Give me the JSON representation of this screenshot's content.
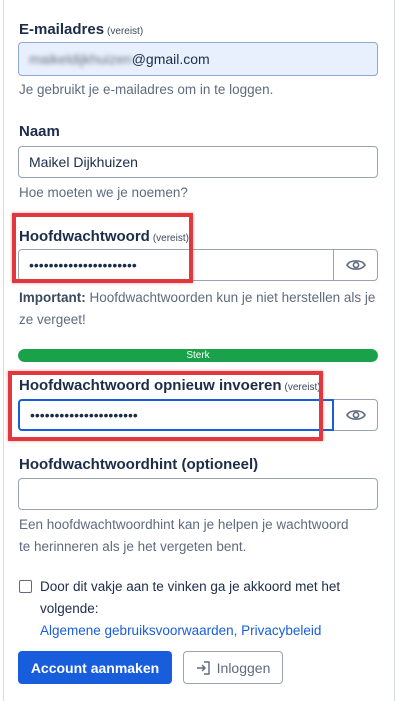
{
  "email": {
    "label": "E-mailadres",
    "required": "(vereist)",
    "blurred": "maikeldijkhuizen",
    "visible_value": "@gmail.com",
    "hint": "Je gebruikt je e-mailadres om in te loggen."
  },
  "name": {
    "label": "Naam",
    "value": "Maikel Dijkhuizen",
    "hint": "Hoe moeten we je noemen?"
  },
  "password": {
    "label": "Hoofdwachtwoord",
    "required": "(vereist)",
    "masked": "••••••••••••••••••••••",
    "warning_bold": "Important:",
    "warning_text": "Hoofdwachtwoorden kun je niet herstellen als je ze vergeet!"
  },
  "strength": {
    "label": "Sterk",
    "fraction": 1.0,
    "color": "#1aa24a"
  },
  "confirm": {
    "label": "Hoofdwachtwoord opnieuw invoeren",
    "required": "(vereist)",
    "masked": "••••••••••••••••••••••"
  },
  "password_hint": {
    "label": "Hoofdwachtwoordhint (optioneel)",
    "value": "",
    "hint": "Een hoofdwachtwoordhint kan je helpen je wachtwoord te herinneren als je het vergeten bent."
  },
  "terms": {
    "text": "Door dit vakje aan te vinken ga je akkoord met het volgende:",
    "link1": "Algemene gebruiksvoorwaarden",
    "separator": ",",
    "link2": "Privacybeleid",
    "checked": false
  },
  "buttons": {
    "primary": "Account aanmaken",
    "secondary": "Inloggen"
  },
  "icons": {
    "eye": "eye-icon",
    "login": "login-icon"
  },
  "colors": {
    "accent": "#175ddc",
    "highlight": "#e0383f",
    "success": "#1aa24a"
  }
}
